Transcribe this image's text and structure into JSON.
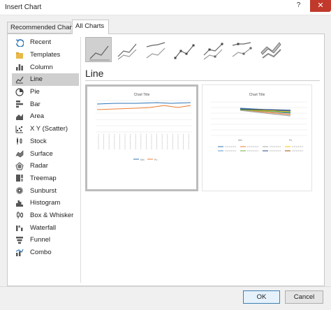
{
  "window": {
    "title": "Insert Chart",
    "help_glyph": "?",
    "close_glyph": "✕"
  },
  "tabs": [
    {
      "label": "Recommended Charts"
    },
    {
      "label": "All Charts"
    }
  ],
  "sidebar": {
    "items": [
      {
        "label": "Recent",
        "icon": "recent-icon"
      },
      {
        "label": "Templates",
        "icon": "templates-icon"
      },
      {
        "label": "Column",
        "icon": "column-icon"
      },
      {
        "label": "Line",
        "icon": "line-icon",
        "selected": true
      },
      {
        "label": "Pie",
        "icon": "pie-icon"
      },
      {
        "label": "Bar",
        "icon": "bar-icon"
      },
      {
        "label": "Area",
        "icon": "area-icon"
      },
      {
        "label": "X Y (Scatter)",
        "icon": "scatter-icon"
      },
      {
        "label": "Stock",
        "icon": "stock-icon"
      },
      {
        "label": "Surface",
        "icon": "surface-icon"
      },
      {
        "label": "Radar",
        "icon": "radar-icon"
      },
      {
        "label": "Treemap",
        "icon": "treemap-icon"
      },
      {
        "label": "Sunburst",
        "icon": "sunburst-icon"
      },
      {
        "label": "Histogram",
        "icon": "histogram-icon"
      },
      {
        "label": "Box & Whisker",
        "icon": "box-whisker-icon"
      },
      {
        "label": "Waterfall",
        "icon": "waterfall-icon"
      },
      {
        "label": "Funnel",
        "icon": "funnel-icon"
      },
      {
        "label": "Combo",
        "icon": "combo-icon"
      }
    ]
  },
  "subtypes": [
    {
      "name": "line-subtype",
      "selected": true
    },
    {
      "name": "stacked-line-subtype"
    },
    {
      "name": "100-stacked-line-subtype"
    },
    {
      "name": "line-with-markers-subtype"
    },
    {
      "name": "stacked-line-with-markers-subtype"
    },
    {
      "name": "100-stacked-line-with-markers-subtype"
    },
    {
      "name": "3d-line-subtype"
    }
  ],
  "main": {
    "section_title": "Line"
  },
  "previews": [
    {
      "chart_title": "Chart Title",
      "legend": [
        "Min",
        "Pu"
      ]
    },
    {
      "chart_title": "Chart Title",
      "x_categories": [
        "Min",
        "Pu"
      ]
    }
  ],
  "buttons": {
    "ok_label": "OK",
    "cancel_label": "Cancel"
  },
  "colors": {
    "accent": "#2e75b6",
    "orange": "#ed7d31",
    "gray": "#a5a5a5",
    "yellow": "#ffc000",
    "blue2": "#5b9bd5",
    "green": "#70ad47"
  }
}
